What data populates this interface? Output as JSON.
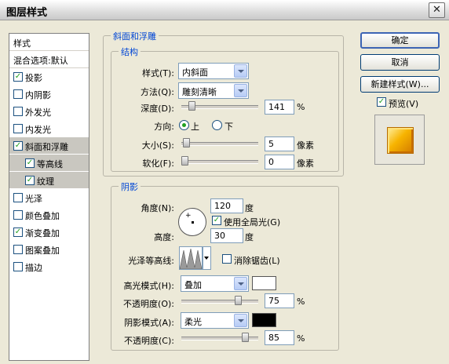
{
  "window": {
    "title": "图层样式",
    "close_glyph": "✕"
  },
  "style_list": {
    "header": "样式",
    "blend_options": "混合选项:默认",
    "items": [
      {
        "label": "投影",
        "checked": true
      },
      {
        "label": "内阴影",
        "checked": false
      },
      {
        "label": "外发光",
        "checked": false
      },
      {
        "label": "内发光",
        "checked": false
      },
      {
        "label": "斜面和浮雕",
        "checked": true,
        "selected": true
      },
      {
        "label": "等高线",
        "checked": true,
        "sub": true
      },
      {
        "label": "纹理",
        "checked": true,
        "sub": true
      },
      {
        "label": "光泽",
        "checked": false
      },
      {
        "label": "颜色叠加",
        "checked": false
      },
      {
        "label": "渐变叠加",
        "checked": true
      },
      {
        "label": "图案叠加",
        "checked": false
      },
      {
        "label": "描边",
        "checked": false
      }
    ]
  },
  "bevel": {
    "group_title": "斜面和浮雕",
    "structure_title": "结构",
    "style_label": "样式(T):",
    "style_value": "内斜面",
    "technique_label": "方法(Q):",
    "technique_value": "雕刻清晰",
    "depth_label": "深度(D):",
    "depth_value": "141",
    "depth_unit": "%",
    "depth_level": 0.1,
    "direction_label": "方向:",
    "direction_up": "上",
    "direction_down": "下",
    "size_label": "大小(S):",
    "size_value": "5",
    "size_unit": "像素",
    "size_level": 0.02,
    "soften_label": "软化(F):",
    "soften_value": "0",
    "soften_unit": "像素",
    "soften_level": 0.0
  },
  "shading": {
    "title": "阴影",
    "angle_label": "角度(N):",
    "angle_value": "120",
    "angle_unit": "度",
    "global_light_label": "使用全局光(G)",
    "altitude_label": "高度:",
    "altitude_value": "30",
    "altitude_unit": "度",
    "gloss_label": "光泽等高线:",
    "antialias_label": "消除锯齿(L)",
    "highlight_label": "高光模式(H):",
    "highlight_value": "叠加",
    "highlight_color": "#ffffff",
    "highlight_opacity_label": "不透明度(O):",
    "highlight_opacity_value": "75",
    "highlight_opacity_unit": "%",
    "shadow_label": "阴影模式(A):",
    "shadow_value": "柔光",
    "shadow_color": "#000000",
    "shadow_opacity_label": "不透明度(C):",
    "shadow_opacity_value": "85",
    "shadow_opacity_unit": "%"
  },
  "buttons": {
    "ok": "确定",
    "cancel": "取消",
    "new_style": "新建样式(W)...",
    "preview": "预览(V)"
  }
}
